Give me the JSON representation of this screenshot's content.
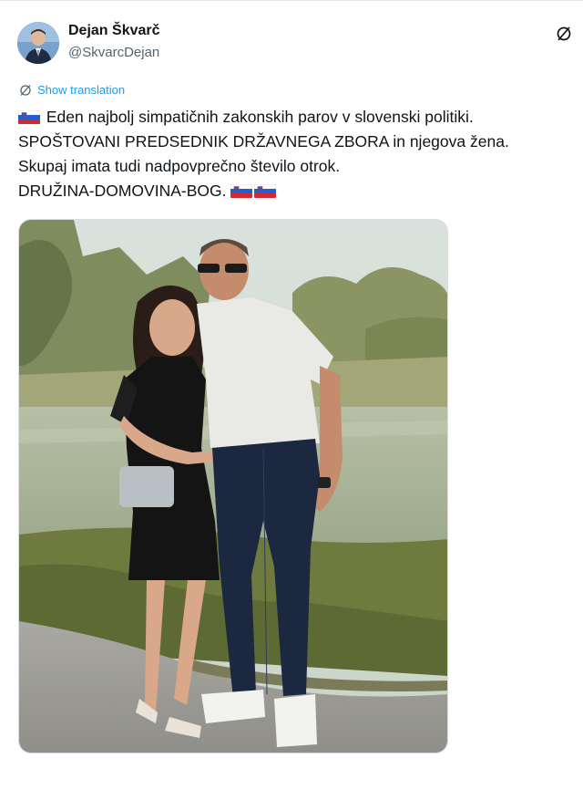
{
  "author": {
    "display_name": "Dejan Škvarč",
    "handle": "@SkvarcDejan",
    "avatar_icon": "profile-photo"
  },
  "translation": {
    "label": "Show translation",
    "icon": "globe-icon"
  },
  "tweet": {
    "line1": "Eden najbolj simpatičnih zakonskih parov v slovenski politiki.",
    "line2": "SPOŠTOVANI PREDSEDNIK DRŽAVNEGA ZBORA in njegova žena.",
    "line3": "Skupaj imata tudi nadpovprečno število otrok.",
    "line4": "DRUŽINA-DOMOVINA-BOG.",
    "emoji": "slovenia-flag"
  },
  "media": {
    "type": "photo",
    "description_icon": "photo-couple"
  },
  "colors": {
    "accent": "#1d9bf0",
    "text": "#0f1419",
    "secondary": "#536471"
  },
  "brand_icon": "x-logo-icon"
}
